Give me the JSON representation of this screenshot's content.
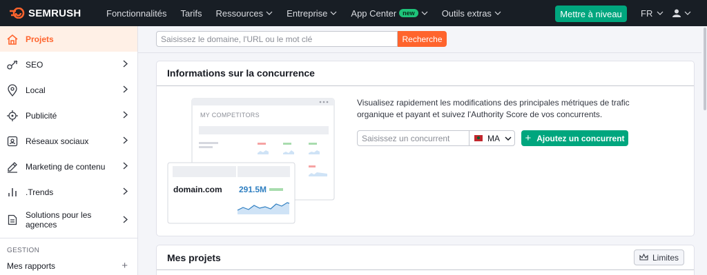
{
  "topbar": {
    "logo_text": "SEMRUSH",
    "nav": [
      {
        "label": "Fonctionnalités",
        "dropdown": false
      },
      {
        "label": "Tarifs",
        "dropdown": false
      },
      {
        "label": "Ressources",
        "dropdown": true
      },
      {
        "label": "Entreprise",
        "dropdown": true
      },
      {
        "label": "App Center",
        "dropdown": true,
        "badge": "new"
      },
      {
        "label": "Outils extras",
        "dropdown": true
      }
    ],
    "upgrade_label": "Mettre à niveau",
    "language": "FR",
    "user_icon": "user-icon"
  },
  "search": {
    "placeholder": "Saisissez le domaine, l'URL ou le mot clé",
    "button_label": "Recherche"
  },
  "sidebar": {
    "items": [
      {
        "label": "Projets",
        "icon": "home-icon",
        "active": true
      },
      {
        "label": "SEO",
        "icon": "seo-icon"
      },
      {
        "label": "Local",
        "icon": "location-pin-icon"
      },
      {
        "label": "Publicité",
        "icon": "target-icon"
      },
      {
        "label": "Réseaux sociaux",
        "icon": "social-icon"
      },
      {
        "label": "Marketing de contenu",
        "icon": "pencil-icon"
      },
      {
        "label": ".Trends",
        "icon": "bars-icon"
      },
      {
        "label": "Solutions pour les agences",
        "icon": "document-icon"
      }
    ],
    "section_label": "GESTION",
    "sub_items": [
      {
        "label": "Mes rapports"
      }
    ]
  },
  "competitors": {
    "title": "Informations sur la concurrence",
    "description": "Visualisez rapidement les modifications des principales métriques de trafic organique et payant et suivez l'Authority Score de vos concurrents.",
    "input_placeholder": "Saisissez un concurrent",
    "country": "MA",
    "add_button": "Ajoutez un concurrent",
    "illustration": {
      "window_title": "MY COMPETITORS",
      "domain": "domain.com",
      "value": "291.5M"
    }
  },
  "projects": {
    "title": "Mes projets",
    "limits_label": "Limites"
  },
  "colors": {
    "brand": "#ff642d",
    "accent_green": "#00a67e",
    "topbar_bg": "#181e25",
    "value_blue": "#2f7fc1"
  }
}
